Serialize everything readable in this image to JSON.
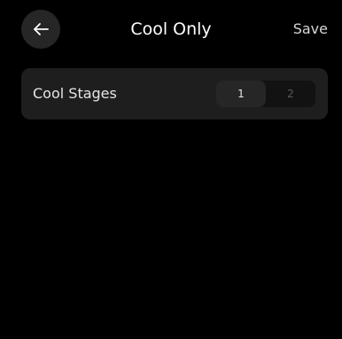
{
  "header": {
    "title": "Cool Only",
    "save_label": "Save",
    "back_icon": "arrow-left-icon"
  },
  "settings": {
    "cool_stages": {
      "label": "Cool Stages",
      "options": [
        "1",
        "2"
      ],
      "selected": "1"
    }
  },
  "colors": {
    "background": "#000000",
    "card": "#1e1e1e",
    "back_button_bg": "#262626",
    "segment_selected_bg": "#262626",
    "segment_unselected_text": "#5a5a5a"
  }
}
